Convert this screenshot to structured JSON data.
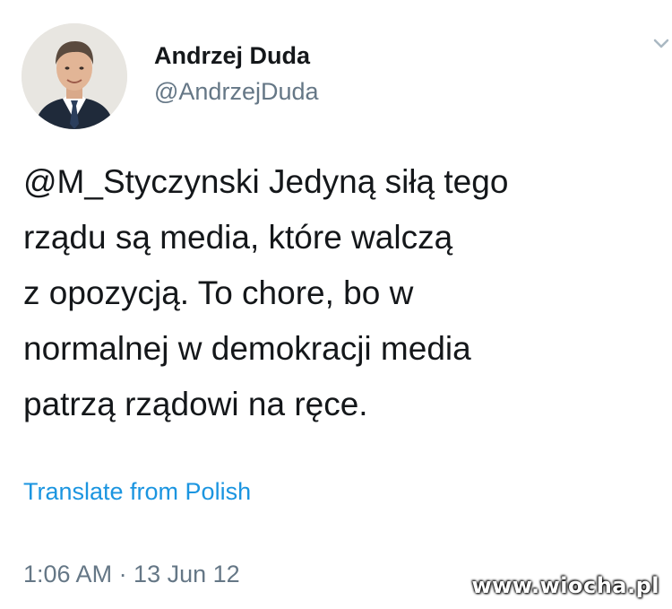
{
  "user": {
    "display_name": "Andrzej Duda",
    "handle": "@AndrzejDuda"
  },
  "tweet": {
    "lines": [
      "@M_Styczynski Jedyną siłą tego",
      "rządu są media, które walczą",
      "z opozycją. To chore, bo w",
      "normalnej w demokracji media",
      "patrzą rządowi na ręce."
    ]
  },
  "translate_label": "Translate from Polish",
  "timestamp": "1:06 AM · 13 Jun 12",
  "watermark": "www.wiocha.pl",
  "icons": {
    "menu": "chevron-down-icon"
  },
  "colors": {
    "link": "#1b95e0",
    "secondary_text": "#657786",
    "primary_text": "#14171a"
  }
}
